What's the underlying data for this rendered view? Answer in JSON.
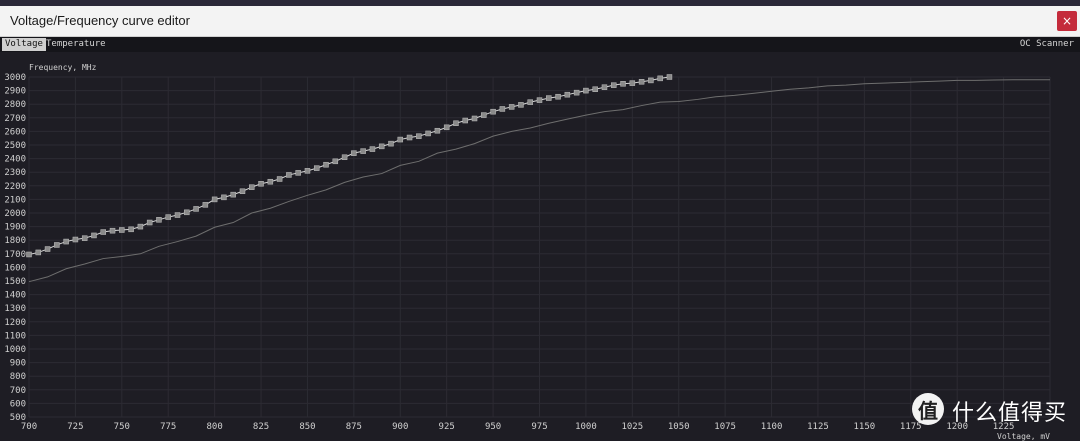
{
  "window": {
    "title": "Voltage/Frequency curve editor",
    "close_label": "×"
  },
  "tabs": [
    {
      "label": "Voltage",
      "active": true
    },
    {
      "label": "Temperature",
      "active": false
    }
  ],
  "oc_scanner_label": "OC Scanner",
  "watermark": {
    "logo_glyph": "值",
    "text": "什么值得买"
  },
  "chart_data": {
    "type": "line",
    "xlabel": "Voltage, mV",
    "ylabel": "Frequency, MHz",
    "xlim": [
      700,
      1250
    ],
    "ylim": [
      500,
      3000
    ],
    "x_ticks": [
      700,
      725,
      750,
      775,
      800,
      825,
      850,
      875,
      900,
      925,
      950,
      975,
      1000,
      1025,
      1050,
      1075,
      1100,
      1125,
      1150,
      1175,
      1200,
      1225,
      1250
    ],
    "x_tick_labels": [
      "700",
      "725",
      "750",
      "775",
      "800",
      "825",
      "850",
      "875",
      "900",
      "925",
      "950",
      "975",
      "1000",
      "1025",
      "1050",
      "1075",
      "1100",
      "1125",
      "1150",
      "1175",
      "1200",
      "1225",
      ""
    ],
    "y_ticks": [
      500,
      600,
      700,
      800,
      900,
      1000,
      1100,
      1200,
      1300,
      1400,
      1500,
      1600,
      1700,
      1800,
      1900,
      2000,
      2100,
      2200,
      2300,
      2400,
      2500,
      2600,
      2700,
      2800,
      2900,
      3000
    ],
    "grid": true,
    "accent_colors": {
      "edited_curve": "#d6d6d6",
      "default_curve": "#6e6e6e",
      "point": "#8a8a8a"
    },
    "series": [
      {
        "x": [
          700,
          705,
          710,
          715,
          720,
          725,
          730,
          735,
          740,
          745,
          750,
          755,
          760,
          765,
          770,
          775,
          780,
          785,
          790,
          795,
          800,
          805,
          810,
          815,
          820,
          825,
          830,
          835,
          840,
          845,
          850,
          855,
          860,
          865,
          870,
          875,
          880,
          885,
          890,
          895,
          900,
          905,
          910,
          915,
          920,
          925,
          930,
          935,
          940,
          945,
          950,
          955,
          960,
          965,
          970,
          975,
          980,
          985,
          990,
          995,
          1000,
          1005,
          1010,
          1015,
          1020,
          1025,
          1030,
          1035,
          1040,
          1045
        ],
        "values": [
          1695,
          1710,
          1735,
          1765,
          1790,
          1805,
          1815,
          1835,
          1860,
          1870,
          1875,
          1880,
          1900,
          1930,
          1950,
          1970,
          1985,
          2005,
          2030,
          2060,
          2100,
          2115,
          2135,
          2160,
          2190,
          2215,
          2230,
          2250,
          2280,
          2295,
          2310,
          2330,
          2355,
          2380,
          2410,
          2440,
          2455,
          2470,
          2490,
          2510,
          2540,
          2555,
          2565,
          2585,
          2605,
          2630,
          2660,
          2680,
          2695,
          2720,
          2745,
          2765,
          2780,
          2795,
          2815,
          2830,
          2845,
          2855,
          2870,
          2885,
          2900,
          2910,
          2925,
          2940,
          2950,
          2955,
          2965,
          2975,
          2990,
          3000
        ]
      },
      {
        "x": [
          700,
          710,
          720,
          730,
          740,
          750,
          760,
          770,
          780,
          790,
          800,
          810,
          820,
          830,
          840,
          850,
          860,
          870,
          880,
          890,
          900,
          910,
          920,
          930,
          940,
          950,
          960,
          970,
          980,
          990,
          1000,
          1010,
          1020,
          1030,
          1040,
          1050,
          1060,
          1070,
          1080,
          1090,
          1100,
          1110,
          1120,
          1130,
          1140,
          1150,
          1160,
          1170,
          1180,
          1190,
          1200,
          1210,
          1220,
          1230,
          1240,
          1250
        ],
        "values": [
          1495,
          1530,
          1590,
          1625,
          1665,
          1680,
          1700,
          1755,
          1790,
          1830,
          1895,
          1930,
          2000,
          2035,
          2085,
          2130,
          2170,
          2225,
          2265,
          2290,
          2350,
          2380,
          2440,
          2470,
          2510,
          2565,
          2600,
          2625,
          2660,
          2690,
          2720,
          2745,
          2760,
          2790,
          2815,
          2820,
          2835,
          2855,
          2865,
          2880,
          2895,
          2910,
          2920,
          2935,
          2940,
          2950,
          2955,
          2960,
          2965,
          2970,
          2975,
          2975,
          2978,
          2980,
          2980,
          2980
        ]
      }
    ]
  }
}
